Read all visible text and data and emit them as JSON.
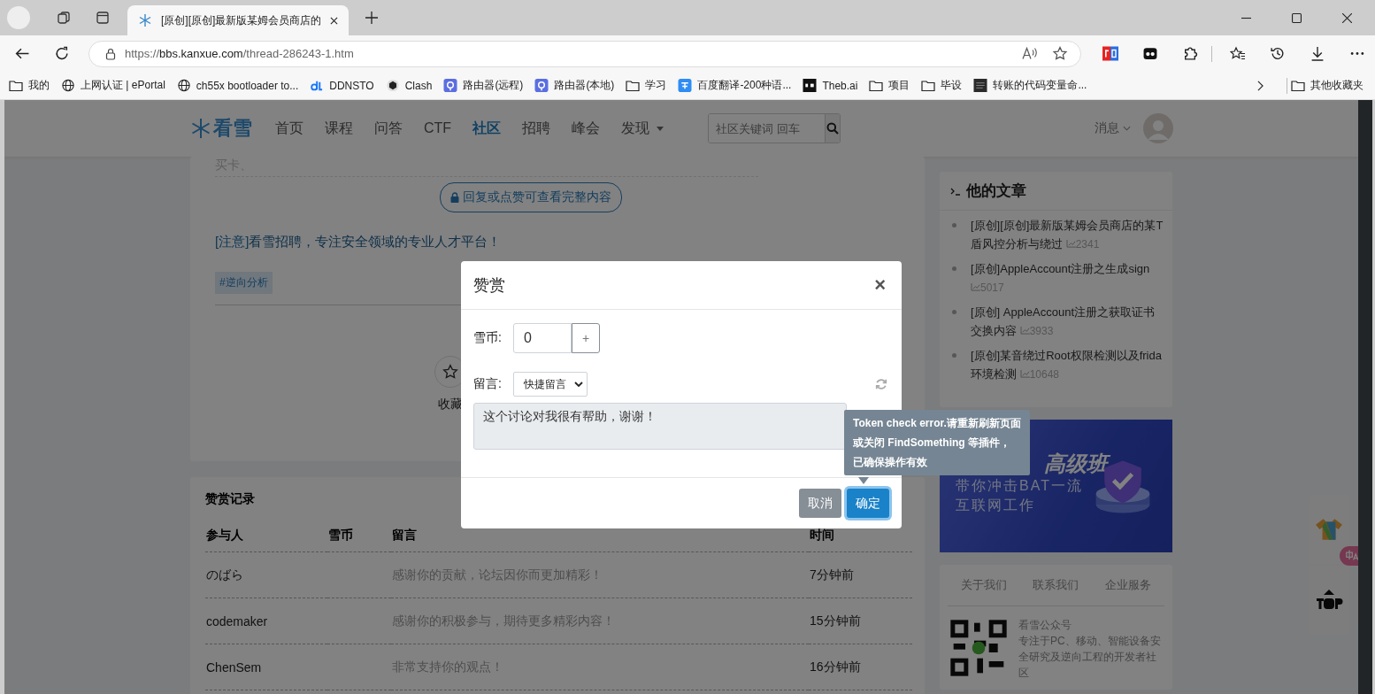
{
  "browser": {
    "tabs": [
      {
        "title": "[原创][原创]最新版某姆会员商店的",
        "selected": true
      }
    ],
    "url": {
      "scheme": "https://",
      "host": "bbs.kanxue.com",
      "path": "/thread-286243-1.htm"
    },
    "bookmarks": [
      {
        "label": "我的",
        "kind": "folder"
      },
      {
        "label": "上网认证 | ePortal",
        "kind": "globe"
      },
      {
        "label": "ch55x bootloader to...",
        "kind": "globe"
      },
      {
        "label": "DDNSTO",
        "kind": "ddnsto"
      },
      {
        "label": "Clash",
        "kind": "clash"
      },
      {
        "label": "路由器(远程)",
        "kind": "router"
      },
      {
        "label": "路由器(本地)",
        "kind": "router"
      },
      {
        "label": "学习",
        "kind": "folder"
      },
      {
        "label": "百度翻译-200种语...",
        "kind": "translate"
      },
      {
        "label": "Theb.ai",
        "kind": "theb"
      },
      {
        "label": "项目",
        "kind": "folder"
      },
      {
        "label": "毕设",
        "kind": "folder"
      },
      {
        "label": "转账的代码变量命...",
        "kind": "doc"
      }
    ],
    "other_bookmarks": "其他收藏夹"
  },
  "site": {
    "logo": "看雪",
    "nav": [
      {
        "label": "首页",
        "selected": false,
        "has_menu": false
      },
      {
        "label": "课程",
        "selected": false,
        "has_menu": false
      },
      {
        "label": "问答",
        "selected": false,
        "has_menu": false
      },
      {
        "label": "CTF",
        "selected": false,
        "has_menu": false
      },
      {
        "label": "社区",
        "selected": true,
        "has_menu": false
      },
      {
        "label": "招聘",
        "selected": false,
        "has_menu": false
      },
      {
        "label": "峰会",
        "selected": false,
        "has_menu": false
      },
      {
        "label": "发现",
        "selected": false,
        "has_menu": true
      }
    ],
    "search": {
      "placeholder": "社区关键词 回车"
    },
    "messages": "消息"
  },
  "post": {
    "cut_text": "买卡、",
    "unlock_button": "回复或点赞可查看完整内容",
    "notice": {
      "tag": "[注意]",
      "text": "看雪招聘，专注安全领域的专业人才平台！"
    },
    "tags": [
      "#逆向分析"
    ],
    "favorite": "收藏"
  },
  "reward_records": {
    "title": "赞赏记录",
    "columns": [
      "参与人",
      "雪币",
      "留言",
      "时间"
    ],
    "rows": [
      {
        "user": "のばら",
        "coins": "",
        "message": "感谢你的贡献，论坛因你而更加精彩！",
        "time": "7分钟前"
      },
      {
        "user": "codemaker",
        "coins": "",
        "message": "感谢你的积极参与，期待更多精彩内容！",
        "time": "15分钟前"
      },
      {
        "user": "ChenSem",
        "coins": "",
        "message": "非常支持你的观点！",
        "time": "16分钟前"
      }
    ]
  },
  "sidebar": {
    "articles": {
      "title": "他的文章",
      "items": [
        {
          "title": "[原创][原创]最新版某姆会员商店的某T盾风控分析与绕过",
          "views": "2341"
        },
        {
          "title": "[原创]AppleAccount注册之生成sign",
          "views": "5017"
        },
        {
          "title": "[原创] AppleAccount注册之获取证书交换内容",
          "views": "3933"
        },
        {
          "title": "[原创]某音绕过Root权限检测以及frida环境检测",
          "views": "10648"
        }
      ]
    },
    "banner": {
      "title": "高级班",
      "lines": [
        "带你冲击BAT一流",
        "互联网工作"
      ]
    },
    "footer_links": [
      "关于我们",
      "联系我们",
      "企业服务"
    ],
    "wechat": {
      "title": "看雪公众号",
      "description": "专注于PC、移动、智能设备安全研究及逆向工程的开发者社区"
    }
  },
  "modal": {
    "title": "赞赏",
    "close": "×",
    "coin_label": "雪币:",
    "coin_value": "0",
    "stepper": "+",
    "message_label": "留言:",
    "quick_select": "快捷留言",
    "message": "这个讨论对我很有帮助，谢谢！",
    "cancel": "取消",
    "confirm": "确定",
    "tooltip": [
      "Token check error.请重新刷新页面",
      "或关闭 FindSomething 等插件，",
      "已确保操作有效"
    ]
  }
}
